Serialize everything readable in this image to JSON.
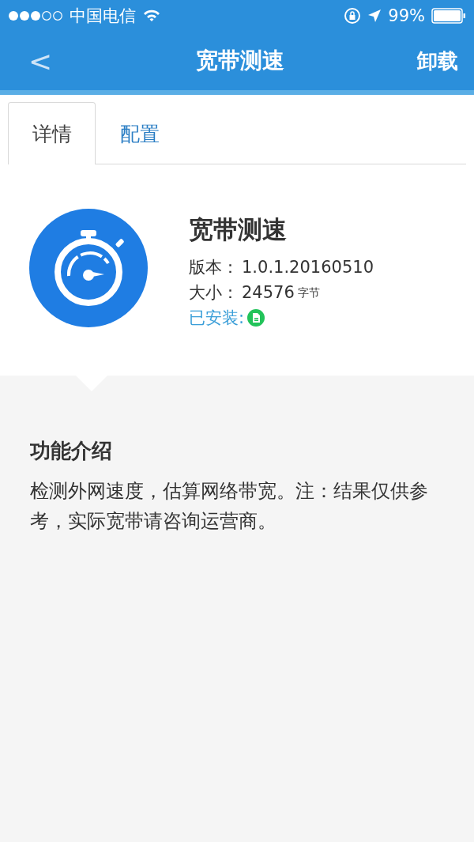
{
  "status_bar": {
    "carrier": "中国电信",
    "battery": "99%"
  },
  "nav": {
    "back": "<",
    "title": "宽带测速",
    "action": "卸载"
  },
  "tabs": [
    {
      "label": "详情",
      "selected": true
    },
    {
      "label": "配置",
      "selected": false
    }
  ],
  "app": {
    "name": "宽带测速",
    "version_label": "版本：",
    "version": "1.0.1.20160510",
    "size_label": "大小：",
    "size": "24576",
    "size_unit": "字节",
    "installed_label": "已安装:"
  },
  "intro": {
    "title": "功能介绍",
    "text": "检测外网速度，估算网络带宽。注：结果仅供参考，实际宽带请咨询运营商。"
  }
}
